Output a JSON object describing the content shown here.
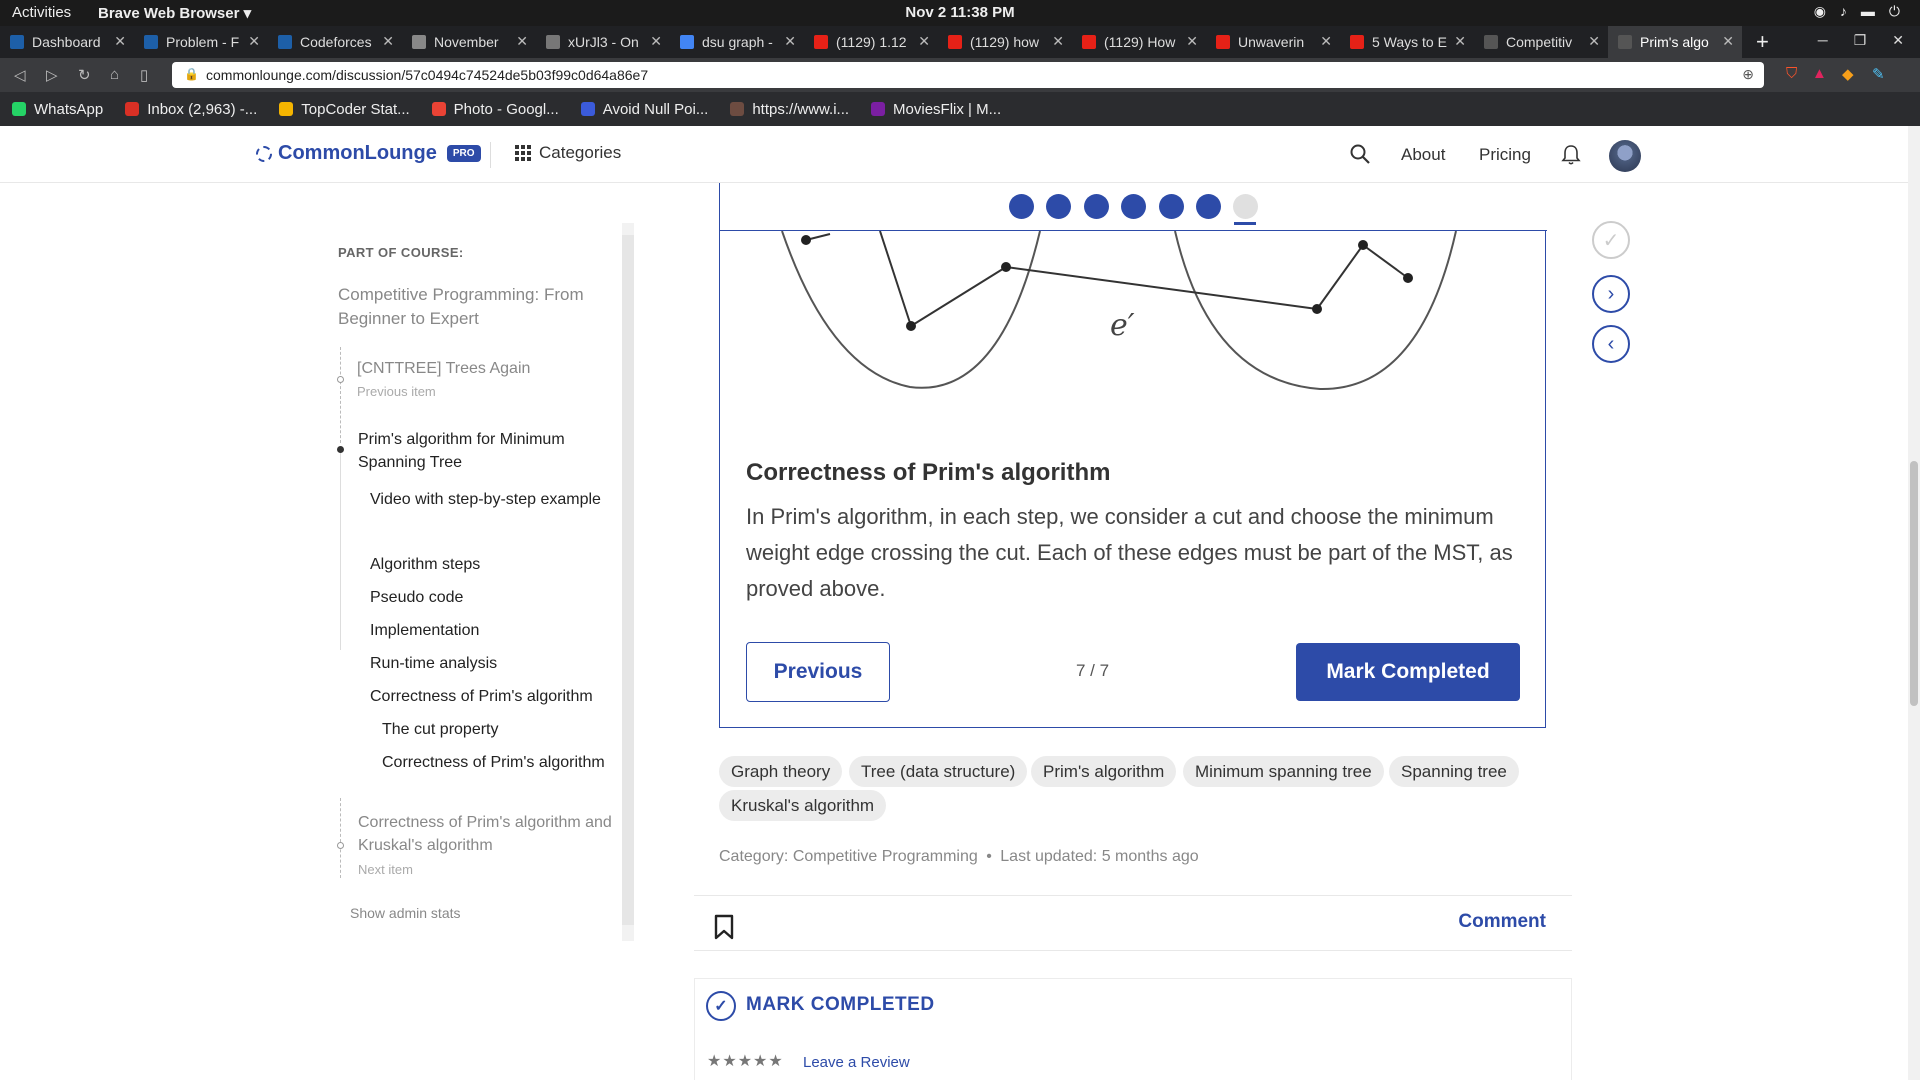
{
  "system_bar": {
    "activities": "Activities",
    "app_name": "Brave Web Browser ▾",
    "clock": "Nov 2  11:38 PM"
  },
  "tabs": [
    {
      "label": "Dashboard",
      "color": "#1d5fa8"
    },
    {
      "label": "Problem - F",
      "color": "#1d5fa8"
    },
    {
      "label": "Codeforces",
      "color": "#1d5fa8"
    },
    {
      "label": "November",
      "color": "#888888"
    },
    {
      "label": "xUrJl3 - On",
      "color": "#777777"
    },
    {
      "label": "dsu graph -",
      "color": "#4285f4"
    },
    {
      "label": "(1129) 1.12",
      "color": "#e62117"
    },
    {
      "label": "(1129) how",
      "color": "#e62117"
    },
    {
      "label": "(1129) How",
      "color": "#e62117"
    },
    {
      "label": "Unwaverin",
      "color": "#e62117"
    },
    {
      "label": "5 Ways to E",
      "color": "#e62117"
    },
    {
      "label": "Competitiv",
      "color": "#555555"
    },
    {
      "label": "Prim's algo",
      "color": "#555555",
      "active": true
    }
  ],
  "address_bar": {
    "url": "commonlounge.com/discussion/57c0494c74524de5b03f99c0d64a86e7"
  },
  "bookmarks": [
    {
      "label": "WhatsApp",
      "color": "#25d366"
    },
    {
      "label": "Inbox (2,963) -...",
      "color": "#d93025"
    },
    {
      "label": "TopCoder Stat...",
      "color": "#f4b400"
    },
    {
      "label": "Photo - Googl...",
      "color": "#ea4335"
    },
    {
      "label": "Avoid Null Poi...",
      "color": "#3b5bdb"
    },
    {
      "label": "https://www.i...",
      "color": "#6d4c41"
    },
    {
      "label": "MoviesFlix | M...",
      "color": "#7b1fa2"
    }
  ],
  "header": {
    "logo": "CommonLounge",
    "pro_badge": "PRO",
    "categories": "Categories",
    "about": "About",
    "pricing": "Pricing"
  },
  "sidebar": {
    "part_label": "PART OF COURSE:",
    "course_title": "Competitive Programming: From Beginner to Expert",
    "previous_item": "[CNTTREE] Trees Again",
    "previous_note": "Previous item",
    "current_item": "Prim's algorithm for Minimum Spanning Tree",
    "sections": [
      "Video with step-by-step example",
      "Algorithm steps",
      "Pseudo code",
      "Implementation",
      "Run-time analysis",
      "Correctness of Prim's algorithm"
    ],
    "subsections": [
      "The cut property",
      "Correctness of Prim's algorithm"
    ],
    "next_item": "Correctness of Prim's algorithm and Kruskal's algorithm",
    "next_note": "Next item",
    "admin_link": "Show admin stats"
  },
  "card": {
    "progress": {
      "total": 7,
      "current": 7
    },
    "diagram_label": "e′",
    "heading": "Correctness of Prim's algorithm",
    "body": "In Prim's algorithm, in each step, we consider a cut and choose the minimum weight edge crossing the cut. Each of these edges must be part of the MST, as proved above.",
    "previous_button": "Previous",
    "pager": "7 / 7",
    "mark_button": "Mark Completed"
  },
  "tags": [
    "Graph theory",
    "Tree (data structure)",
    "Prim's algorithm",
    "Minimum spanning tree",
    "Spanning tree",
    "Kruskal's algorithm"
  ],
  "meta": {
    "category": "Category: Competitive Programming",
    "separator": "•",
    "updated": "Last updated: 5 months ago"
  },
  "footer": {
    "comment": "Comment"
  },
  "mark_panel": {
    "title": "MARK COMPLETED",
    "stars": "★★★★★",
    "review": "Leave a Review"
  },
  "colors": {
    "accent": "#2d4ba8"
  }
}
